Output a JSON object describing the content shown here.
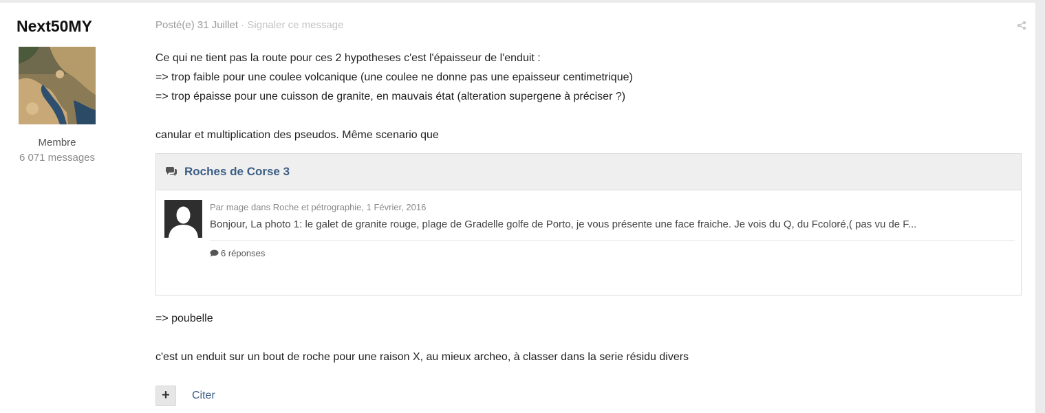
{
  "author": {
    "name": "Next50MY",
    "role": "Membre",
    "post_count": "6 071 messages"
  },
  "meta": {
    "posted": "Posté(e) 31 Juillet",
    "separator": "·",
    "report": "Signaler ce message"
  },
  "body": {
    "line1": "Ce qui ne tient pas la route pour ces 2 hypotheses c'est l'épaisseur de l'enduit :",
    "line2": "=> trop faible pour une coulee volcanique (une coulee ne donne pas une epaisseur centimetrique)",
    "line3": "=> trop épaisse pour une cuisson de granite, en mauvais état (alteration supergene à préciser ?)",
    "line4": "canular et multiplication des pseudos. Même scenario que",
    "line5": "=> poubelle",
    "line6": "c'est un enduit sur un bout de roche pour une raison X, au mieux archeo, à classer dans la serie résidu divers"
  },
  "embed": {
    "title": "Roches de Corse 3",
    "byline": "Par mage dans Roche et pétrographie, 1 Février, 2016",
    "snippet": "Bonjour, La photo 1: le galet de granite rouge, plage de Gradelle golfe de Porto, je vous présente une face fraiche. Je vois du Q, du Fcoloré,( pas vu de F...",
    "replies": "6 réponses"
  },
  "actions": {
    "plus_label": "+",
    "quote_label": "Citer"
  },
  "colors": {
    "link": "#3b5d85",
    "muted": "#999999",
    "embed_header_bg": "#efefef"
  },
  "icons": [
    "share-icon",
    "comments-icon",
    "comment-bubble-icon",
    "user-silhouette-icon"
  ]
}
